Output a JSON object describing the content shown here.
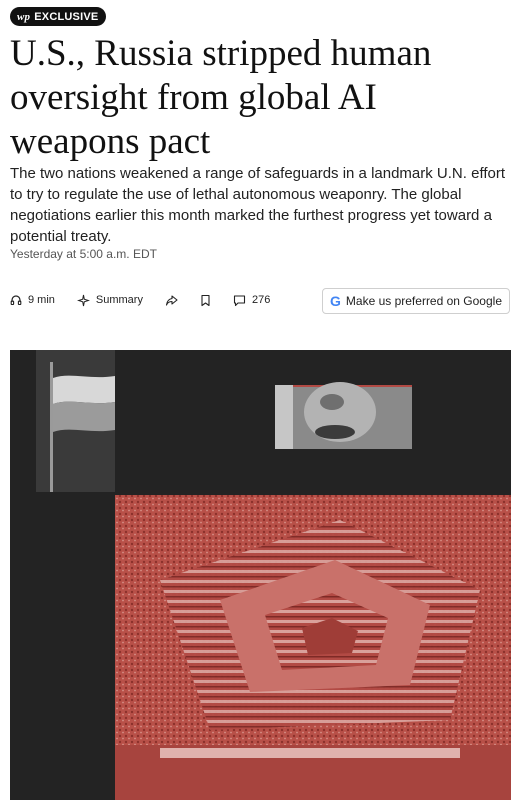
{
  "badge": {
    "logo": "wp",
    "label": "EXCLUSIVE"
  },
  "headline": "U.S., Russia stripped human oversight from global AI weapons pact",
  "dek": "The two nations weakened a range of safeguards in a landmark U.N. effort to try to regulate the use of lethal autonomous weaponry. The global negotiations earlier this month marked the furthest progress yet toward a potential treaty.",
  "timestamp": "Yesterday at 5:00 a.m. EDT",
  "toolbar": {
    "listen_label": "9 min",
    "summary_label": "Summary",
    "comments_count": "276",
    "preferred_button": {
      "google_letter": "G",
      "label": "Make us preferred on Google"
    }
  },
  "hero": {
    "icons": [
      "flag-image",
      "face-image",
      "pentagon-aerial-image"
    ]
  },
  "colors": {
    "accent_red": "#b24a44",
    "dark_bg": "#232323",
    "badge_bg": "#111111"
  }
}
